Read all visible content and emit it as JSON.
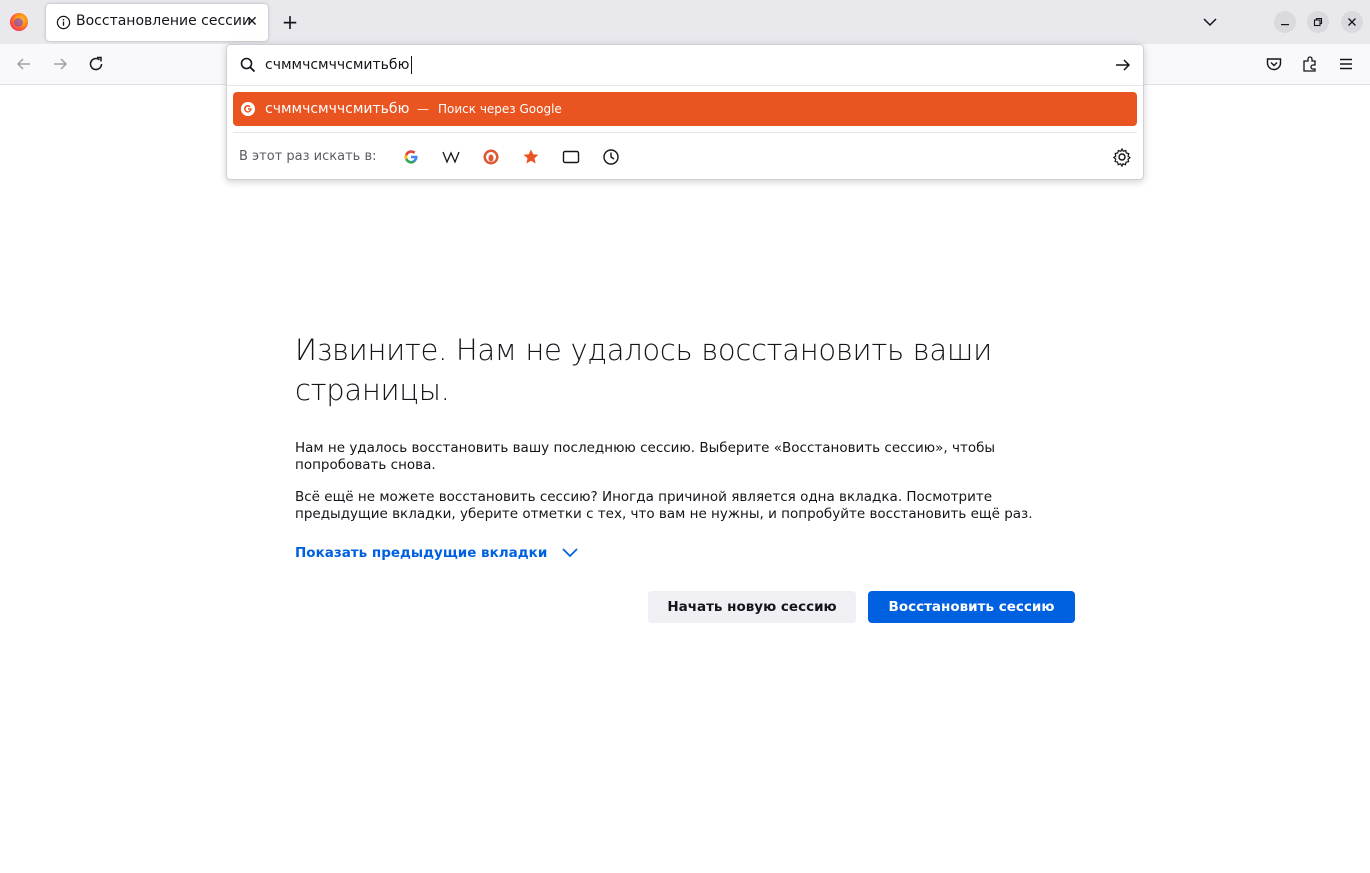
{
  "tabbar": {
    "tab_title": "Восстановление сессии",
    "close_glyph": "✕",
    "newtab_glyph": "+"
  },
  "urlbar": {
    "value": "счммчсмччсмитьбю",
    "result": {
      "text": "счммчсмччсмитьбю",
      "dash": "—",
      "action": "Поиск через Google"
    },
    "oneoff_label": "В этот раз искать в:",
    "engines": [
      "google-icon",
      "wikipedia-icon",
      "duckduckgo-icon",
      "bookmarks-icon",
      "tabs-icon",
      "history-icon"
    ]
  },
  "page": {
    "title": "Извините. Нам не удалось восстановить ваши страницы.",
    "p1": "Нам не удалось восстановить вашу последнюю сессию. Выберите «Восстановить сессию», чтобы попробовать снова.",
    "p2": "Всё ещё не можете восстановить сессию? Иногда причиной является одна вкладка. Посмотрите предыдущие вкладки, уберите отметки с тех, что вам не нужны, и попробуйте восстановить ещё раз.",
    "toggle": "Показать предыдущие вкладки",
    "btn_new": "Начать новую сессию",
    "btn_restore": "Восстановить сессию"
  },
  "colors": {
    "accent": "#e95420",
    "link": "#0061e0",
    "primary_button": "#0061e0"
  }
}
